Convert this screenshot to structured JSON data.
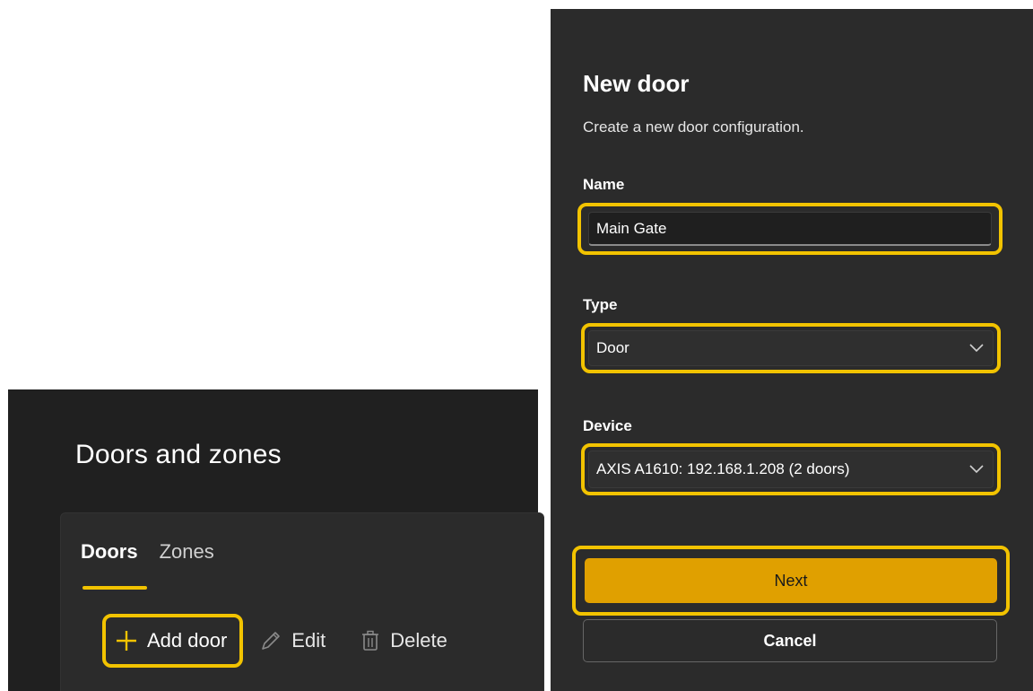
{
  "doors_page": {
    "title": "Doors and zones",
    "tabs": [
      {
        "label": "Doors",
        "active": true
      },
      {
        "label": "Zones",
        "active": false
      }
    ],
    "toolbar": {
      "add_label": "Add door",
      "edit_label": "Edit",
      "delete_label": "Delete"
    }
  },
  "dialog": {
    "title": "New door",
    "subtitle": "Create a new door configuration.",
    "name": {
      "label": "Name",
      "value": "Main Gate"
    },
    "type": {
      "label": "Type",
      "value": "Door"
    },
    "device": {
      "label": "Device",
      "value": "AXIS A1610: 192.168.1.208 (2 doors)"
    },
    "next_label": "Next",
    "cancel_label": "Cancel"
  },
  "colors": {
    "highlight": "#f2c300",
    "primary_button": "#e0a000",
    "panel_bg": "#202020",
    "dialog_bg": "#2b2b2b"
  },
  "icons": {
    "add": "plus-icon",
    "edit": "pencil-icon",
    "delete": "trash-icon",
    "dropdown": "chevron-down-icon"
  }
}
